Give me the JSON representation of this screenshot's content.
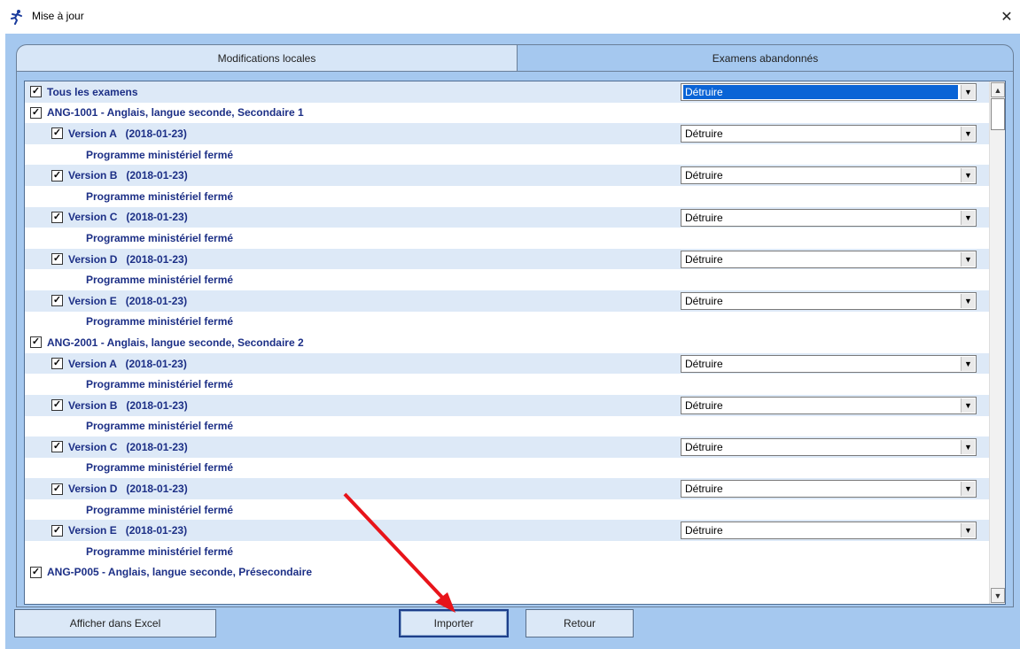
{
  "window": {
    "title": "Mise à jour",
    "close_glyph": "✕",
    "icon": "running-figure-icon"
  },
  "tabs": [
    {
      "label": "Modifications locales",
      "active": false
    },
    {
      "label": "Examens abandonnés",
      "active": true
    }
  ],
  "list": {
    "rows": [
      {
        "level": 0,
        "checked": true,
        "label": "Tous les examens",
        "action": "Détruire",
        "selected": true,
        "shaded": true
      },
      {
        "level": 0,
        "checked": true,
        "label": "ANG-1001 - Anglais, langue seconde, Secondaire 1",
        "action": null,
        "shaded": false
      },
      {
        "level": 1,
        "checked": true,
        "label": "Version A   (2018-01-23)",
        "action": "Détruire",
        "shaded": true
      },
      {
        "level": 2,
        "checked": null,
        "label": "Programme ministériel fermé",
        "action": null,
        "shaded": false
      },
      {
        "level": 1,
        "checked": true,
        "label": "Version B   (2018-01-23)",
        "action": "Détruire",
        "shaded": true
      },
      {
        "level": 2,
        "checked": null,
        "label": "Programme ministériel fermé",
        "action": null,
        "shaded": false
      },
      {
        "level": 1,
        "checked": true,
        "label": "Version C   (2018-01-23)",
        "action": "Détruire",
        "shaded": true
      },
      {
        "level": 2,
        "checked": null,
        "label": "Programme ministériel fermé",
        "action": null,
        "shaded": false
      },
      {
        "level": 1,
        "checked": true,
        "label": "Version D   (2018-01-23)",
        "action": "Détruire",
        "shaded": true
      },
      {
        "level": 2,
        "checked": null,
        "label": "Programme ministériel fermé",
        "action": null,
        "shaded": false
      },
      {
        "level": 1,
        "checked": true,
        "label": "Version E   (2018-01-23)",
        "action": "Détruire",
        "shaded": true
      },
      {
        "level": 2,
        "checked": null,
        "label": "Programme ministériel fermé",
        "action": null,
        "shaded": false
      },
      {
        "level": 0,
        "checked": true,
        "label": "ANG-2001 - Anglais, langue seconde, Secondaire 2",
        "action": null,
        "shaded": false
      },
      {
        "level": 1,
        "checked": true,
        "label": "Version A   (2018-01-23)",
        "action": "Détruire",
        "shaded": true
      },
      {
        "level": 2,
        "checked": null,
        "label": "Programme ministériel fermé",
        "action": null,
        "shaded": false
      },
      {
        "level": 1,
        "checked": true,
        "label": "Version B   (2018-01-23)",
        "action": "Détruire",
        "shaded": true
      },
      {
        "level": 2,
        "checked": null,
        "label": "Programme ministériel fermé",
        "action": null,
        "shaded": false
      },
      {
        "level": 1,
        "checked": true,
        "label": "Version C   (2018-01-23)",
        "action": "Détruire",
        "shaded": true
      },
      {
        "level": 2,
        "checked": null,
        "label": "Programme ministériel fermé",
        "action": null,
        "shaded": false
      },
      {
        "level": 1,
        "checked": true,
        "label": "Version D   (2018-01-23)",
        "action": "Détruire",
        "shaded": true
      },
      {
        "level": 2,
        "checked": null,
        "label": "Programme ministériel fermé",
        "action": null,
        "shaded": false
      },
      {
        "level": 1,
        "checked": true,
        "label": "Version E   (2018-01-23)",
        "action": "Détruire",
        "shaded": true
      },
      {
        "level": 2,
        "checked": null,
        "label": "Programme ministériel fermé",
        "action": null,
        "shaded": false
      },
      {
        "level": 0,
        "checked": true,
        "label": "ANG-P005 - Anglais, langue seconde, Présecondaire",
        "action": null,
        "shaded": false
      }
    ]
  },
  "buttons": {
    "excel": "Afficher dans Excel",
    "import": "Importer",
    "back": "Retour"
  },
  "colors": {
    "client_bg": "#a5c8ef",
    "row_shade": "#dde9f7",
    "row_text": "#1c2f86",
    "selection": "#0a64d6",
    "annotation_arrow": "#e8141a"
  },
  "icons": {
    "checkbox_mark": "☑",
    "combo_arrow": "▼",
    "scroll_up": "▲",
    "scroll_down": "▼"
  }
}
